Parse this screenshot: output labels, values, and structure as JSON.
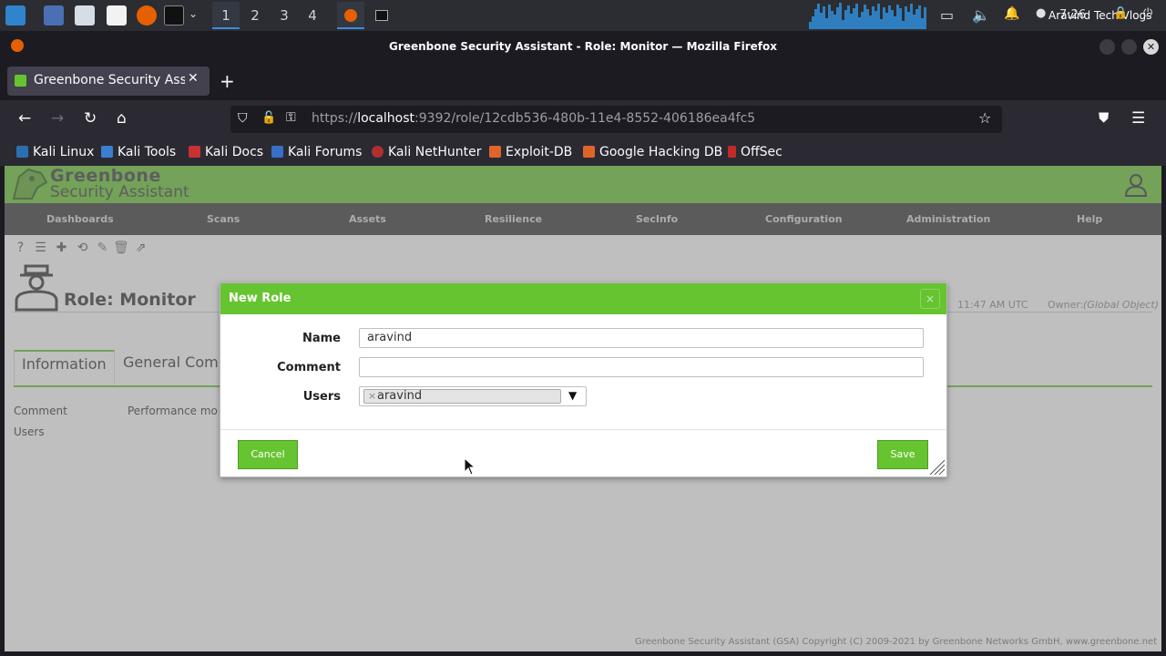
{
  "taskbar": {
    "workspaces": [
      "1",
      "2",
      "3",
      "4"
    ],
    "clock": "7:26",
    "user": "Aravind Tech Vlogs",
    "icons": [
      "kali-menu-icon",
      "desktop-icon",
      "files-icon",
      "text-editor-icon",
      "firefox-icon",
      "terminal-icon",
      "chevron-down-icon"
    ]
  },
  "browser": {
    "window_title": "Greenbone Security Assistant - Role: Monitor — Mozilla Firefox",
    "tab_title": "Greenbone Security Assistant",
    "url_prefix": "https://",
    "url_host": "localhost",
    "url_rest": ":9392/role/12cdb536-480b-11e4-8552-406186ea4fc5",
    "bookmarks": [
      "Kali Linux",
      "Kali Tools",
      "Kali Docs",
      "Kali Forums",
      "Kali NetHunter",
      "Exploit-DB",
      "Google Hacking DB",
      "OffSec"
    ]
  },
  "gsa": {
    "brand_line1": "Greenbone",
    "brand_line2": "Security Assistant",
    "menu": [
      "Dashboards",
      "Scans",
      "Assets",
      "Resilience",
      "SecInfo",
      "Configuration",
      "Administration",
      "Help"
    ],
    "page_title": "Role: Monitor",
    "modified": "11:47 AM UTC",
    "owner_label": "Owner:",
    "owner_value": "(Global Object)",
    "tabs": [
      "Information",
      "General Com"
    ],
    "info_rows": [
      {
        "label": "Comment",
        "value": "Performance mo"
      },
      {
        "label": "Users",
        "value": ""
      }
    ],
    "footer": "Greenbone Security Assistant (GSA) Copyright (C) 2009-2021 by Greenbone Networks GmbH, www.greenbone.net"
  },
  "dialog": {
    "title": "New Role",
    "close": "×",
    "name_label": "Name",
    "name_value": "aravind",
    "comment_label": "Comment",
    "comment_value": "",
    "users_label": "Users",
    "users_selected": "aravind",
    "users_remove": "×",
    "dropdown_arrow": "▼",
    "cancel": "Cancel",
    "save": "Save"
  },
  "colors": {
    "gsa_green": "#66c430",
    "menu_bg": "#393637",
    "firefox_bg": "#1c1b22"
  }
}
